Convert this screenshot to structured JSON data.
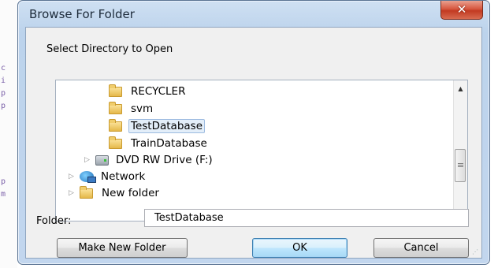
{
  "window": {
    "title": "Browse For Folder",
    "close_glyph": "✕"
  },
  "prompt": "Select Directory to Open",
  "tree": {
    "items": [
      {
        "label": "RECYCLER",
        "icon": "folder-icon",
        "selected": false
      },
      {
        "label": "svm",
        "icon": "folder-icon",
        "selected": false
      },
      {
        "label": "TestDatabase",
        "icon": "folder-icon",
        "selected": true
      },
      {
        "label": "TrainDatabase",
        "icon": "folder-icon",
        "selected": false
      },
      {
        "label": "DVD RW Drive (F:)",
        "icon": "dvd-drive-icon",
        "selected": false
      },
      {
        "label": "Network",
        "icon": "network-icon",
        "selected": false
      },
      {
        "label": "New folder",
        "icon": "folder-icon",
        "selected": false
      }
    ],
    "expander_glyph": "▷"
  },
  "scrollbar": {
    "up_glyph": "▲",
    "down_glyph": "▼"
  },
  "folder_field": {
    "label": "Folder:",
    "value": "TestDatabase"
  },
  "buttons": {
    "new_folder": "Make New Folder",
    "ok": "OK",
    "cancel": "Cancel"
  },
  "colors": {
    "title_bar": "#c2d6ee",
    "close_button": "#c8452a",
    "selection": "#e3eef9",
    "default_button_border": "#3c7fb1"
  }
}
